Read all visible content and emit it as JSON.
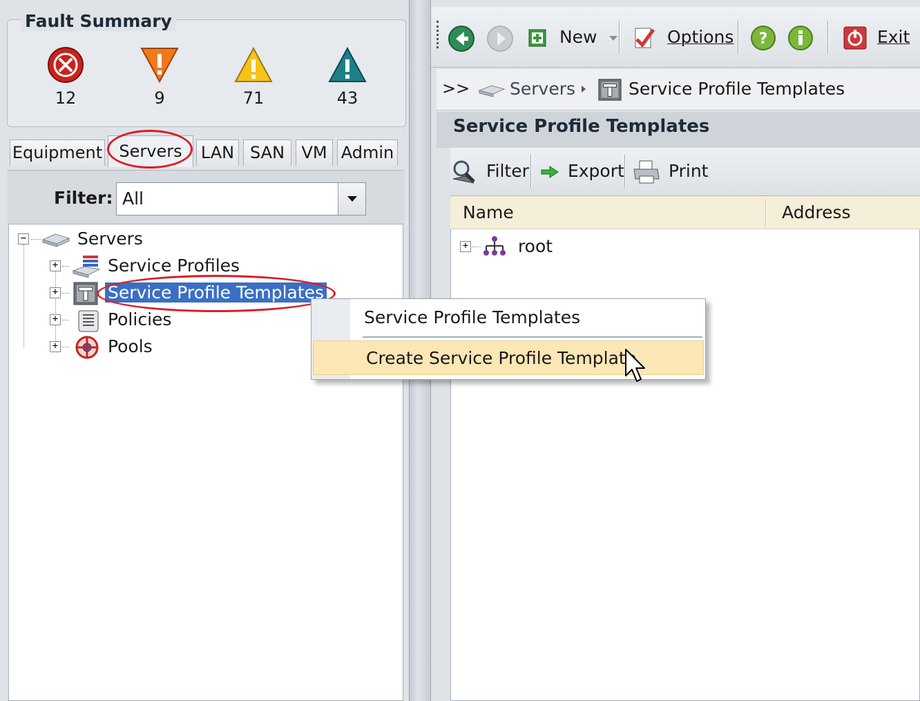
{
  "fault_summary": {
    "title": "Fault Summary",
    "critical": {
      "icon": "critical-x-icon",
      "count": "12",
      "color": "#c8231b"
    },
    "major": {
      "icon": "major-triangle-down-icon",
      "count": "9",
      "color": "#f07a1a"
    },
    "minor": {
      "icon": "minor-warning-icon",
      "count": "71",
      "color": "#f6c21b"
    },
    "warning": {
      "icon": "warning-triangle-icon",
      "count": "43",
      "color": "#1f7f86"
    }
  },
  "nav_tabs": [
    {
      "label": "Equipment"
    },
    {
      "label": "Servers",
      "active": true
    },
    {
      "label": "LAN"
    },
    {
      "label": "SAN"
    },
    {
      "label": "VM"
    },
    {
      "label": "Admin"
    }
  ],
  "filter": {
    "label": "Filter:",
    "value": "All"
  },
  "tree": {
    "root": {
      "label": "Servers",
      "icon": "server-icon"
    },
    "children": [
      {
        "label": "Service Profiles",
        "icon": "service-profiles-icon"
      },
      {
        "label": "Service Profile Templates",
        "icon": "template-t-icon",
        "selected": true
      },
      {
        "label": "Policies",
        "icon": "policies-scroll-icon"
      },
      {
        "label": "Pools",
        "icon": "pools-icon"
      }
    ]
  },
  "toolbar": {
    "back_icon": "back-arrow-icon",
    "forward_icon": "forward-arrow-icon",
    "new_label": "New",
    "options_label": "Options",
    "help_icon": "help-icon",
    "info_icon": "info-icon",
    "exit_label": "Exit"
  },
  "breadcrumb": {
    "prefix": ">>",
    "item1": "Servers",
    "item2": "Service Profile Templates"
  },
  "content": {
    "title": "Service Profile Templates",
    "filter_label": "Filter",
    "export_label": "Export",
    "print_label": "Print",
    "columns": [
      "Name",
      "Address"
    ],
    "rows": [
      {
        "name": "root",
        "icon": "org-tree-icon"
      }
    ]
  },
  "context_menu": {
    "header": "Service Profile Templates",
    "item": "Create Service Profile Template"
  },
  "colors": {
    "highlight_oval": "#d81f26",
    "selection": "#3b6fc4",
    "menu_hover": "#fbe6b6",
    "table_header": "#f5eed9"
  }
}
